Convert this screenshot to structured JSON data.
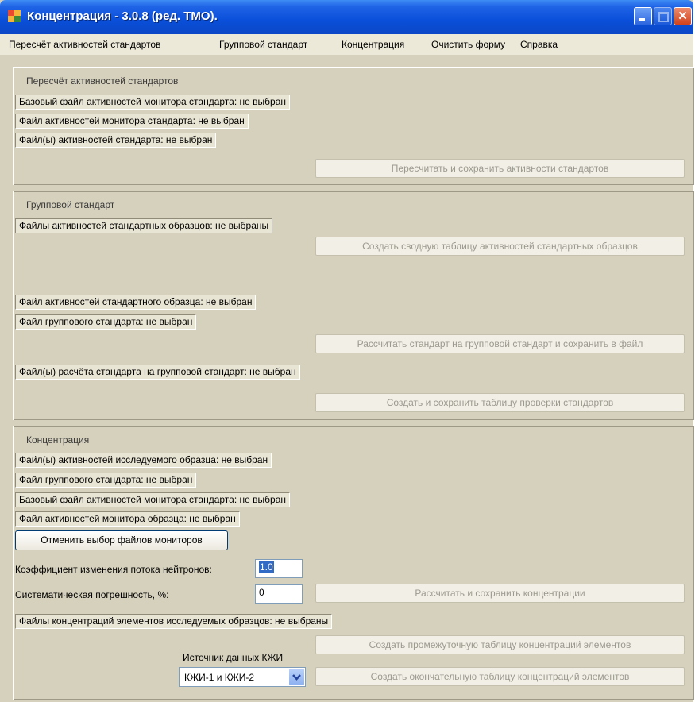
{
  "window": {
    "title": "Концентрация - 3.0.8 (ред. ТМО).",
    "icon": "app-icon",
    "controls": [
      "minimize-icon",
      "maximize-icon",
      "close-icon"
    ]
  },
  "menu": {
    "recalc": "Пересчёт активностей стандартов",
    "group_standard": "Групповой стандарт",
    "concentration": "Концентрация",
    "clear_form": "Очистить форму",
    "help": "Справка"
  },
  "recalc_group": {
    "title": "Пересчёт активностей стандартов",
    "base_monitor_file": "Базовый файл активностей монитора стандарта: не выбран",
    "monitor_file": "Файл активностей монитора стандарта: не выбран",
    "standard_files": "Файл(ы) активностей стандарта: не выбран",
    "recalc_button": "Пересчитать и сохранить активности стандартов"
  },
  "group_standard": {
    "title": "Групповой стандарт",
    "sample_files": "Файлы активностей стандартных образцов: не выбраны",
    "summary_button": "Создать сводную таблицу активностей стандартных образцов",
    "sample_file": "Файл активностей стандартного образца: не выбран",
    "group_file": "Файл группового стандарта: не выбран",
    "calc_button": "Рассчитать стандарт на групповой стандарт и сохранить в файл",
    "calc_files": "Файл(ы) расчёта стандарта на групповой стандарт: не выбран",
    "check_button": "Создать и сохранить таблицу проверки стандартов"
  },
  "concentration": {
    "title": "Концентрация",
    "sample_files": "Файл(ы) активностей исследуемого образца: не выбран",
    "group_file": "Файл группового стандарта: не выбран",
    "base_monitor_file": "Базовый файл активностей монитора стандарта: не выбран",
    "sample_monitor_file": "Файл активностей монитора образца: не выбран",
    "cancel_monitors_button": "Отменить выбор файлов мониторов",
    "flux_label": "Коэффициент изменения потока нейтронов:",
    "flux_value": "1.0",
    "error_label": "Систематическая погрешность, %:",
    "error_value": "0",
    "calc_button": "Рассчитать и сохранить концентрации",
    "result_files": "Файлы концентраций элементов исследуемых образцов: не выбраны",
    "intermediate_button": "Создать промежуточную таблицу концентраций элементов",
    "source_label": "Источник данных КЖИ",
    "source_value": "КЖИ-1 и КЖИ-2",
    "final_button": "Создать окончательную таблицу концентраций элементов"
  }
}
